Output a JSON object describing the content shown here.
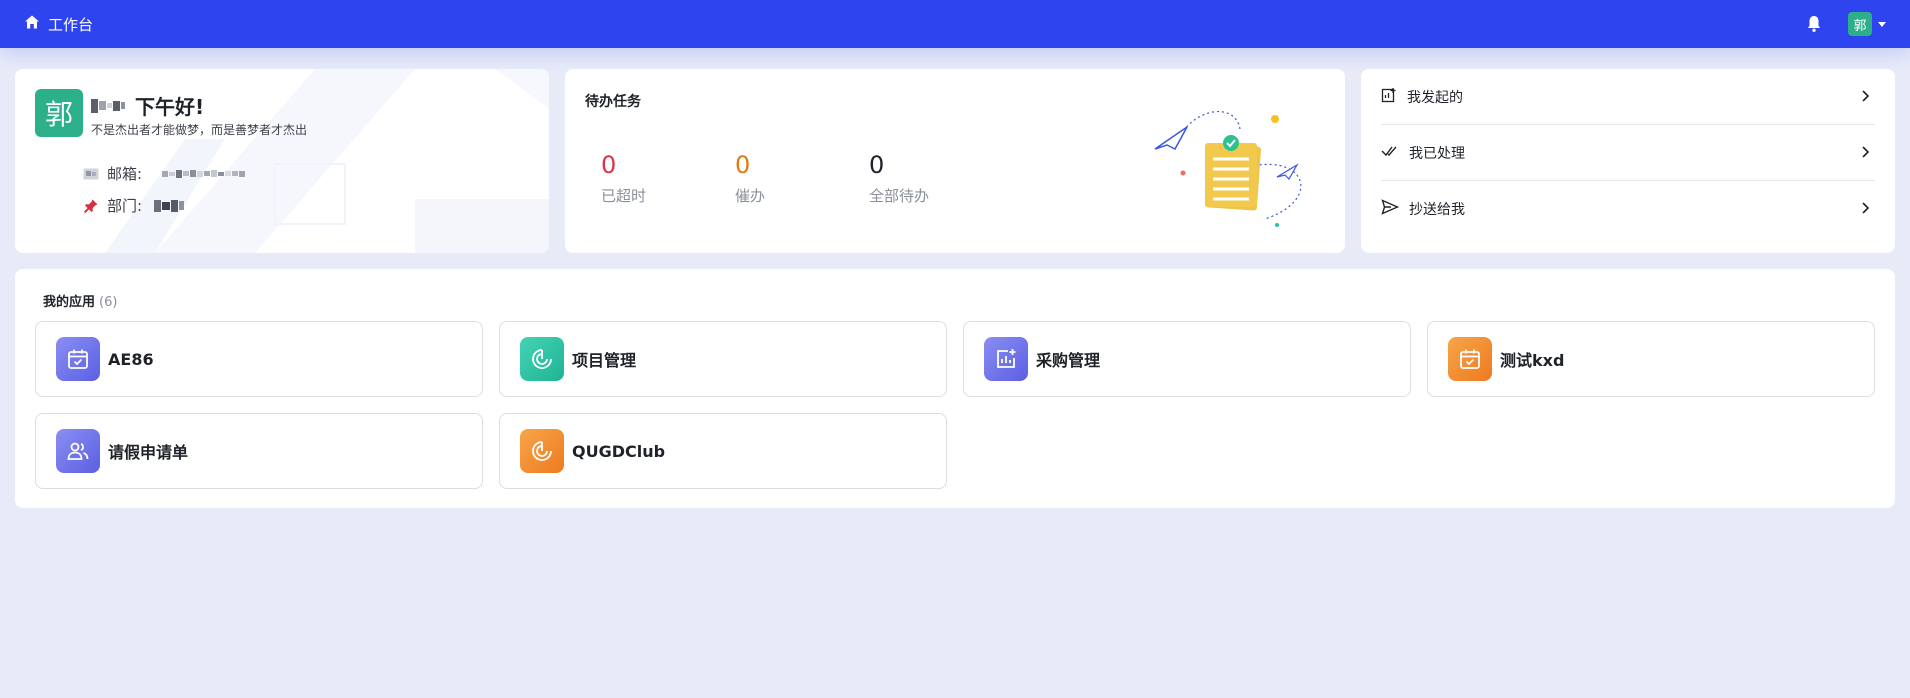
{
  "colors": {
    "topbar": "#2d44ee",
    "avatar": "#2bb08a",
    "overdue": "#e0314b",
    "urge": "#e07b11",
    "all": "#1f2329",
    "page_bg": "#e7ebf8"
  },
  "header": {
    "home_icon": "home-icon",
    "title": "工作台",
    "bell_icon": "bell-icon",
    "avatar_char": "郭"
  },
  "profile": {
    "avatar_char": "郭",
    "greeting": "下午好!",
    "motto": "不是杰出者才能做梦，而是善梦者才杰出",
    "email_label": "邮箱:",
    "dept_label": "部门:"
  },
  "todo": {
    "title": "待办任务",
    "stats": [
      {
        "value": "0",
        "label": "已超时"
      },
      {
        "value": "0",
        "label": "催办"
      },
      {
        "value": "0",
        "label": "全部待办"
      }
    ]
  },
  "quick_links": [
    {
      "label": "我发起的",
      "icon": "start-icon"
    },
    {
      "label": "我已处理",
      "icon": "double-check-icon"
    },
    {
      "label": "抄送给我",
      "icon": "send-icon"
    }
  ],
  "apps": {
    "title": "我的应用",
    "count": "(6)",
    "items": [
      {
        "name": "AE86",
        "icon": "calendar-check-icon",
        "color": "#6a6ee8"
      },
      {
        "name": "项目管理",
        "icon": "target-icon",
        "color": "#2cc0a4"
      },
      {
        "name": "采购管理",
        "icon": "chart-add-icon",
        "color": "#6a6ee8"
      },
      {
        "name": "测试kxd",
        "icon": "calendar-check-icon",
        "color": "#f08a2a"
      },
      {
        "name": "请假申请单",
        "icon": "users-icon",
        "color": "#6a6ee8"
      },
      {
        "name": "QUGDClub",
        "icon": "target-icon",
        "color": "#f08a2a"
      }
    ]
  }
}
